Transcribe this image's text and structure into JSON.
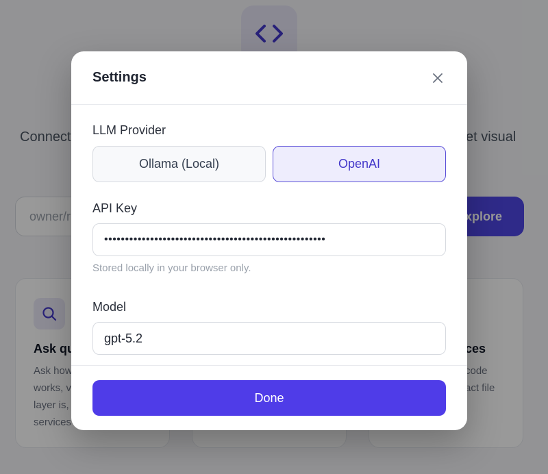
{
  "background": {
    "tagline_left": "Connect",
    "tagline_right": "et visual",
    "repo_input_placeholder": "owner/r",
    "explore_label": "xplore",
    "cards": [
      {
        "title": "Ask qu",
        "body_lines": [
          "Ask how",
          "works, v",
          "layer is,",
          "services"
        ]
      },
      {
        "title": "ces",
        "body_lines": [
          "code",
          "act file"
        ]
      }
    ]
  },
  "modal": {
    "title": "Settings",
    "provider": {
      "label": "LLM Provider",
      "options": [
        "Ollama (Local)",
        "OpenAI"
      ],
      "selected": "OpenAI"
    },
    "api_key": {
      "label": "API Key",
      "value": "•••••••••••••••••••••••••••••••••••••••••••••••••••••",
      "hint": "Stored locally in your browser only."
    },
    "model": {
      "label": "Model",
      "value": "gpt-5.2"
    },
    "done_label": "Done"
  },
  "colors": {
    "accent": "#4f3ce8",
    "selected_bg": "#eeedfd",
    "overlay": "rgba(0,0,0,0.40)"
  },
  "icons": {
    "logo": "code-brackets-icon",
    "close": "close-icon",
    "search": "search-icon"
  }
}
